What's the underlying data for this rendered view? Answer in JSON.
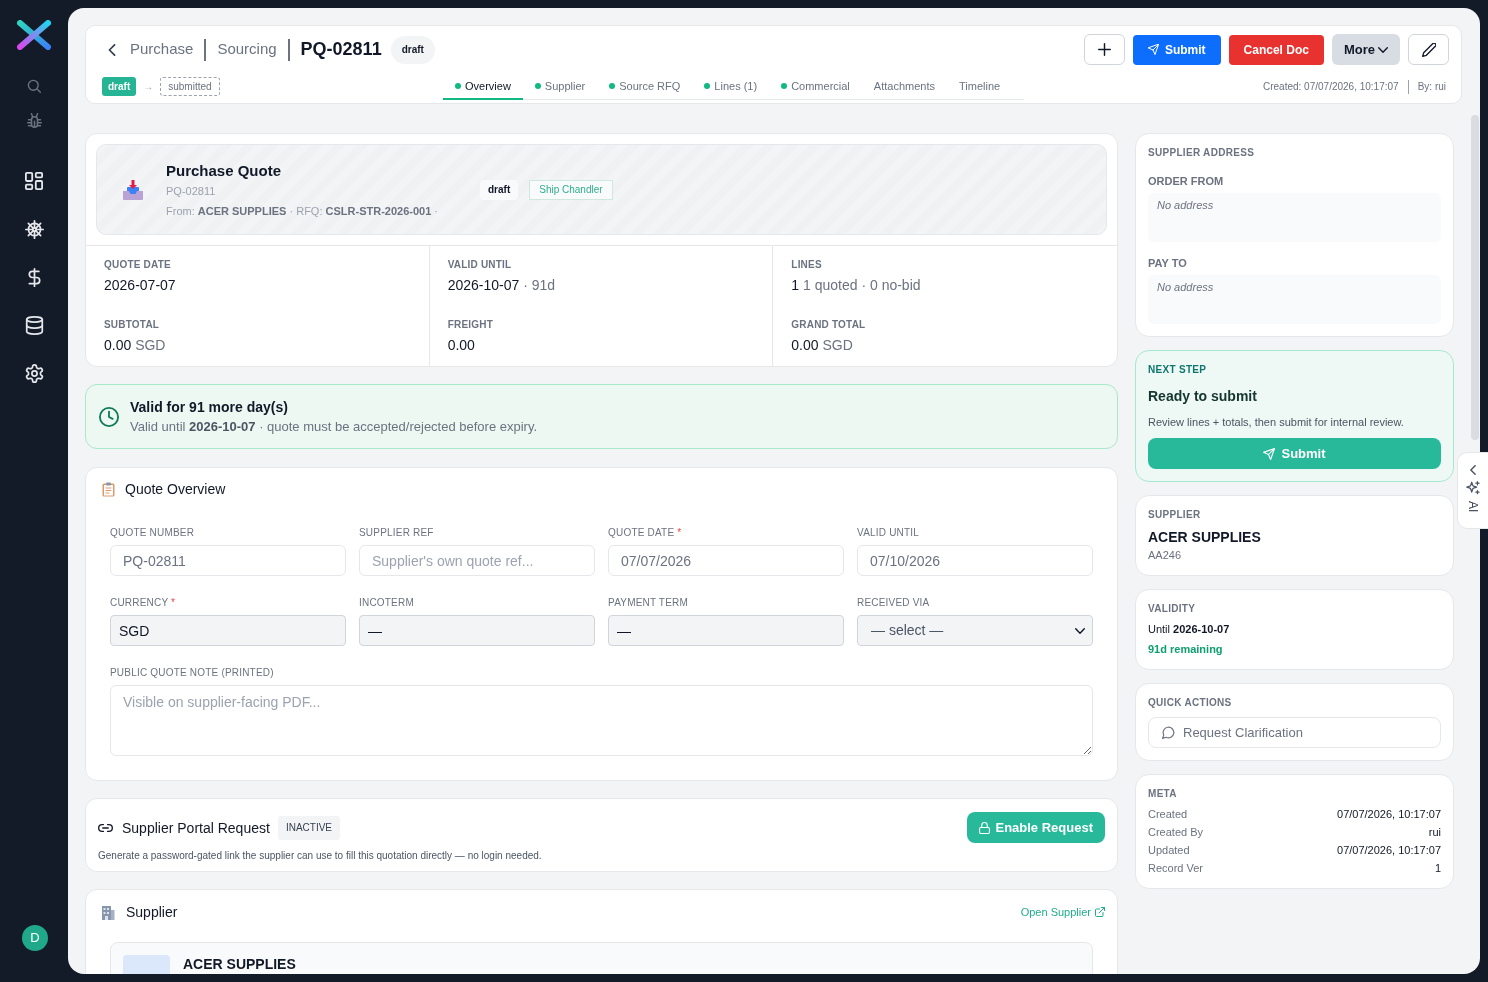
{
  "sidebar": {
    "avatar": "D"
  },
  "header": {
    "breadcrumbs": [
      "Purchase",
      "Sourcing"
    ],
    "title": "PQ-02811",
    "status": "draft",
    "workflow": [
      {
        "label": "draft",
        "kind": "current"
      },
      {
        "label": "submitted",
        "kind": "next"
      }
    ],
    "workflow_arrow": "→",
    "tabs": [
      {
        "label": "Overview",
        "selected": true,
        "has_data": true
      },
      {
        "label": "Supplier",
        "selected": false,
        "has_data": true
      },
      {
        "label": "Source RFQ",
        "selected": false,
        "has_data": true
      },
      {
        "label": "Lines (1)",
        "selected": false,
        "has_data": true
      },
      {
        "label": "Commercial",
        "selected": false,
        "has_data": true
      },
      {
        "label": "Attachments",
        "selected": false,
        "has_data": false
      },
      {
        "label": "Timeline",
        "selected": false,
        "has_data": false
      }
    ],
    "actions": [
      {
        "kind": "add"
      },
      {
        "label": "Submit",
        "kind": "primary"
      },
      {
        "label": "Cancel Doc",
        "kind": "danger"
      },
      {
        "label": "More",
        "kind": "menu"
      },
      {
        "kind": "edit"
      }
    ],
    "created": "Created: 07/07/2026, 10:17:07",
    "created_by": "By: rui"
  },
  "quote_card": {
    "title": "Purchase Quote",
    "number": "PQ-02811",
    "source": "From: **ACER SUPPLIES** · RFQ: **CSLR-STR-2026-001** ·",
    "status": "draft",
    "tag": "Ship Chandler",
    "stats": [
      {
        "label": "QUOTE DATE",
        "value": "2026-07-07"
      },
      {
        "label": "VALID UNTIL",
        "value": "2026-10-07",
        "note": "· 91d"
      },
      {
        "label": "LINES",
        "value": "1",
        "note": "1 quoted · 0 no-bid"
      },
      {
        "label": "SUBTOTAL",
        "value": "0.00",
        "note": "SGD"
      },
      {
        "label": "FREIGHT",
        "value": "0.00"
      },
      {
        "label": "GRAND TOTAL",
        "value": "0.00",
        "note": "SGD"
      }
    ]
  },
  "validity_alert": {
    "title": "Valid for 91 more day(s)",
    "text": "Valid until **2026-10-07** · quote must be accepted/rejected before expiry."
  },
  "quote_overview": {
    "title": "Quote Overview",
    "fields": [
      {
        "label": "QUOTE NUMBER",
        "kind": "plain",
        "value": "PQ-02811"
      },
      {
        "label": "SUPPLIER REF",
        "kind": "plain",
        "placeholder": "Supplier's own quote ref..."
      },
      {
        "label": "QUOTE DATE",
        "required_mark": "*",
        "kind": "plain",
        "value": "07/07/2026"
      },
      {
        "label": "VALID UNTIL",
        "kind": "plain",
        "value": "07/10/2026"
      },
      {
        "label": "CURRENCY",
        "required_mark": "*",
        "kind": "shaded",
        "value": "SGD"
      },
      {
        "label": "INCOTERM",
        "kind": "shaded",
        "value": "—"
      },
      {
        "label": "PAYMENT TERM",
        "kind": "shaded",
        "value": "—"
      },
      {
        "label": "RECEIVED VIA",
        "kind": "select",
        "value": "— select —"
      },
      {
        "label": "PUBLIC QUOTE NOTE (PRINTED)",
        "kind": "textarea",
        "placeholder": "Visible on supplier-facing PDF..."
      }
    ]
  },
  "portal_request": {
    "title": "Supplier Portal Request",
    "status": "INACTIVE",
    "button": "Enable Request",
    "description": "Generate a password-gated link the supplier can use to fill this quotation directly — no login needed."
  },
  "supplier_section": {
    "title": "Supplier",
    "link": "Open Supplier",
    "name": "ACER SUPPLIES"
  },
  "supplier_address": {
    "title": "SUPPLIER ADDRESS",
    "blocks": [
      {
        "label": "ORDER FROM",
        "text": "No address"
      },
      {
        "label": "PAY TO",
        "text": "No address"
      }
    ]
  },
  "next_step": {
    "eyebrow": "NEXT STEP",
    "title": "Ready to submit",
    "text": "Review lines + totals, then submit for internal review.",
    "button": "Submit"
  },
  "supplier_card": {
    "eyebrow": "SUPPLIER",
    "name": "ACER SUPPLIES",
    "code": "AA246"
  },
  "validity": {
    "eyebrow": "VALIDITY",
    "until": "Until **2026-10-07**",
    "remaining": "91d remaining"
  },
  "quick_actions": {
    "eyebrow": "QUICK ACTIONS",
    "buttons": [
      "Request Clarification"
    ]
  },
  "meta": {
    "eyebrow": "META",
    "rows": [
      {
        "label": "Created",
        "value": "07/07/2026, 10:17:07"
      },
      {
        "label": "Created By",
        "value": "rui"
      },
      {
        "label": "Updated",
        "value": "07/07/2026, 10:17:07"
      },
      {
        "label": "Record Ver",
        "value": "1"
      }
    ]
  },
  "ai_tab": {
    "label": "AI"
  }
}
